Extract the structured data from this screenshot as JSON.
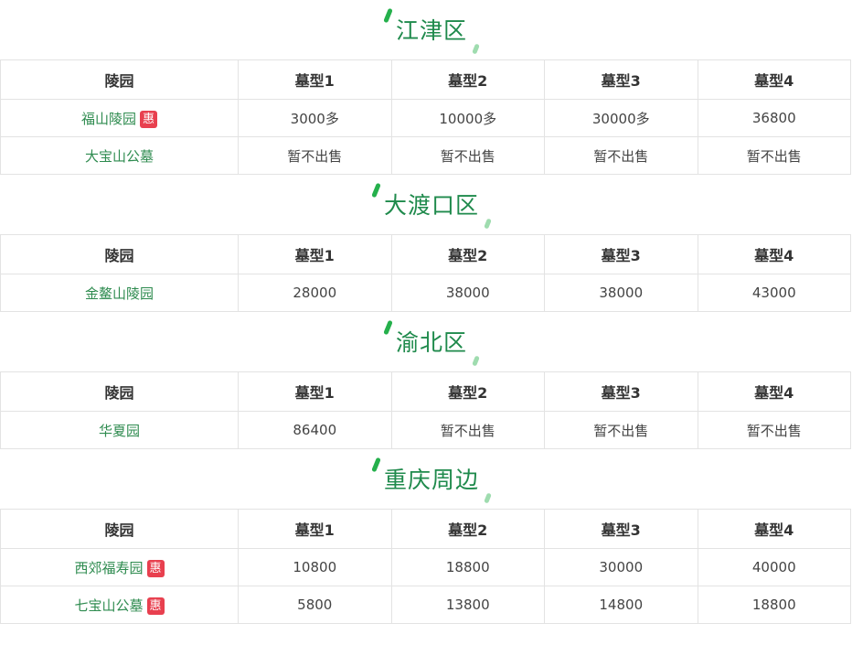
{
  "colors": {
    "title": "#1f8a4c",
    "link": "#2e8b4f",
    "badge": "#e8404f",
    "mark_dark": "#25b04c",
    "mark_light": "#9fdcaf",
    "border": "#e3e3e3"
  },
  "headers": [
    "陵园",
    "墓型1",
    "墓型2",
    "墓型3",
    "墓型4"
  ],
  "sections": [
    {
      "title": "江津区",
      "rows": [
        {
          "name": "福山陵园",
          "badge": "惠",
          "values": [
            "3000多",
            "10000多",
            "30000多",
            "36800"
          ]
        },
        {
          "name": "大宝山公墓",
          "badge": "",
          "values": [
            "暂不出售",
            "暂不出售",
            "暂不出售",
            "暂不出售"
          ]
        }
      ]
    },
    {
      "title": "大渡口区",
      "rows": [
        {
          "name": "金鳌山陵园",
          "badge": "",
          "values": [
            "28000",
            "38000",
            "38000",
            "43000"
          ]
        }
      ]
    },
    {
      "title": "渝北区",
      "rows": [
        {
          "name": "华夏园",
          "badge": "",
          "values": [
            "86400",
            "暂不出售",
            "暂不出售",
            "暂不出售"
          ]
        }
      ]
    },
    {
      "title": "重庆周边",
      "rows": [
        {
          "name": "西郊福寿园",
          "badge": "惠",
          "values": [
            "10800",
            "18800",
            "30000",
            "40000"
          ]
        },
        {
          "name": "七宝山公墓",
          "badge": "惠",
          "values": [
            "5800",
            "13800",
            "14800",
            "18800"
          ]
        }
      ]
    }
  ]
}
